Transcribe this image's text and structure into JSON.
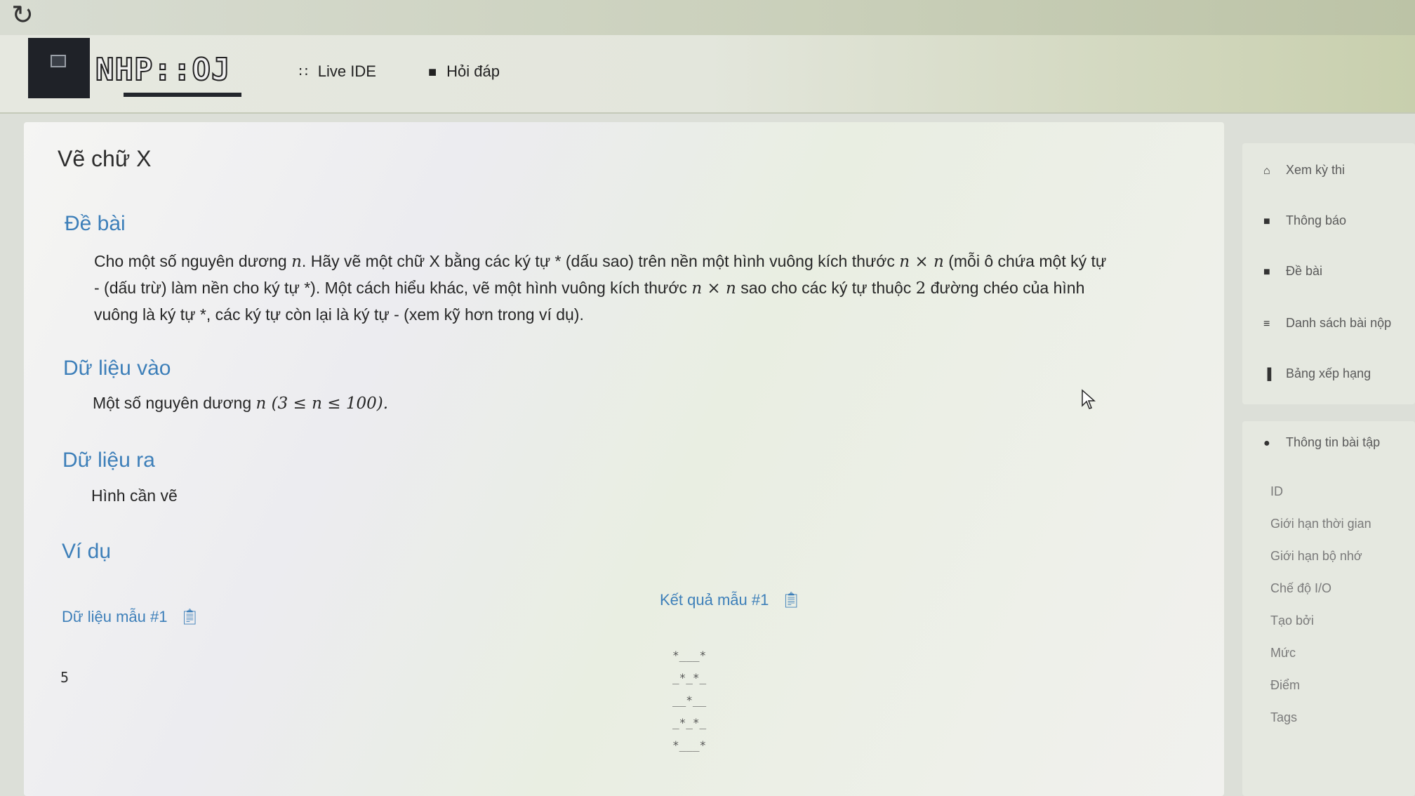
{
  "nav": {
    "logo_text": "NHP::OJ",
    "links": [
      {
        "label": "Live IDE",
        "icon": "grid-icon"
      },
      {
        "label": "Hỏi đáp",
        "icon": "comment-icon"
      }
    ]
  },
  "problem": {
    "title": "Vẽ chữ X",
    "statement_heading": "Đề bài",
    "statement": {
      "l1a": "Cho một số nguyên dương ",
      "n": "n",
      "l1b": ". Hãy vẽ một chữ X bằng các ký tự * (dấu sao) trên nền một hình vuông kích thước ",
      "nxn": "n × n",
      "l1c": " (mỗi ô chứa một ký tự",
      "l2a": "- (dấu trừ) làm nền cho ký tự *). Một cách hiểu khác, vẽ một hình vuông kích thước ",
      "l2b": " sao cho các ký tự thuộc ",
      "two": "2",
      "l2c": " đường chéo của hình",
      "l3": "vuông là ký tự *, các ký tự còn lại là ký tự - (xem kỹ hơn trong ví dụ)."
    },
    "input_heading": "Dữ liệu vào",
    "input_text": "Một số nguyên dương ",
    "input_math": "n (3 ≤ n ≤ 100).",
    "output_heading": "Dữ liệu ra",
    "output_text": "Hình cần vẽ",
    "example_heading": "Ví dụ",
    "sample_input_label": "Dữ liệu mẫu #1",
    "sample_output_label": "Kết quả mẫu #1",
    "sample_input": "5",
    "sample_output": "*___*\n_*_*_\n__*__\n_*_*_\n*___*"
  },
  "sidebar": {
    "menu": [
      {
        "label": "Xem kỳ thi",
        "icon": "home-icon"
      },
      {
        "label": "Thông báo",
        "icon": "comment-icon"
      },
      {
        "label": "Đề bài",
        "icon": "book-icon"
      },
      {
        "label": "Danh sách bài nộp",
        "icon": "list-icon"
      },
      {
        "label": "Bảng xếp hạng",
        "icon": "bar-chart-icon"
      }
    ],
    "info_title": "Thông tin bài tập",
    "info_fields": [
      "ID",
      "Giới hạn thời gian",
      "Giới hạn bộ nhớ",
      "Chế độ I/O",
      "Tạo bởi",
      "Mức",
      "Điểm",
      "Tags"
    ]
  }
}
